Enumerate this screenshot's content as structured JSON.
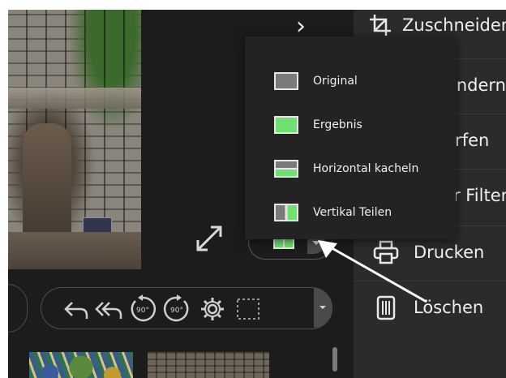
{
  "window": {
    "background": "#1c1c1c"
  },
  "context_panel": {
    "items": [
      {
        "label": "Zuschneiden",
        "icon": "crop-icon"
      },
      {
        "label": "Größe ändern",
        "icon": "resize-icon"
      },
      {
        "label": "Schärfen",
        "icon": "sharpen-icon"
      },
      {
        "label": "Adaptiver Filter",
        "icon": "adaptive-filter-icon"
      },
      {
        "label": "Drucken",
        "icon": "printer-icon"
      },
      {
        "label": "Löschen",
        "icon": "trash-icon"
      }
    ]
  },
  "compare_menu": {
    "items": [
      {
        "label": "Original",
        "icon": "original-view-icon"
      },
      {
        "label": "Ergebnis",
        "icon": "result-view-icon"
      },
      {
        "label": "Horizontal kacheln",
        "icon": "horizontal-tile-icon"
      },
      {
        "label": "Vertikal Teilen",
        "icon": "vertical-split-icon"
      }
    ],
    "accent": "#70e070"
  },
  "toolbar": {
    "buttons": [
      {
        "name": "undo-icon"
      },
      {
        "name": "undo-all-icon"
      },
      {
        "name": "rotate-left-90-icon",
        "text": "90°"
      },
      {
        "name": "rotate-right-90-icon",
        "text": "90°"
      },
      {
        "name": "settings-icon"
      },
      {
        "name": "selection-icon"
      }
    ],
    "rotate_left_text": "90°",
    "rotate_right_text": "90°"
  }
}
